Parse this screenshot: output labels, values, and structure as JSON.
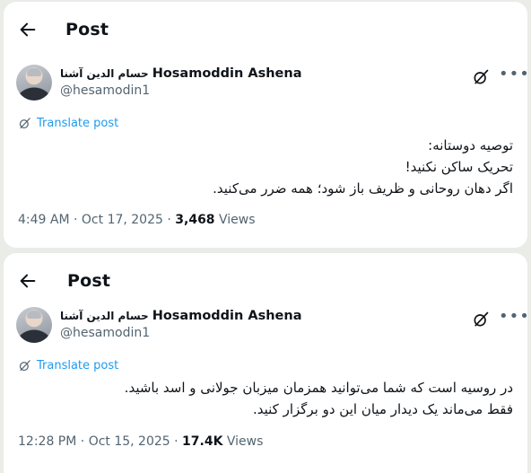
{
  "posts": [
    {
      "header_title": "Post",
      "author": {
        "name_fa": "حسام الدین آشنا",
        "name_en": "Hosamoddin Ashena",
        "handle": "@hesamodin1"
      },
      "translate_label": "Translate post",
      "text_lines": [
        "توصیه دوستانه:",
        "تحریک ساکن نکنید!",
        "اگر دهان روحانی و ظریف باز شود؛ همه ضرر می‌کنید."
      ],
      "time": "4:49 AM",
      "date": "Oct 17, 2025",
      "views_count": "3,468",
      "views_label": "Views"
    },
    {
      "header_title": "Post",
      "author": {
        "name_fa": "حسام الدین آشنا",
        "name_en": "Hosamoddin Ashena",
        "handle": "@hesamodin1"
      },
      "translate_label": "Translate post",
      "text_lines": [
        "در روسیه است که شما می‌توانید همزمان میزبان جولانی و اسد باشید.",
        "فقط می‌ماند یک دیدار میان این دو برگزار کنید."
      ],
      "time": "12:28 PM",
      "date": "Oct 15, 2025",
      "views_count": "17.4K",
      "views_label": "Views"
    }
  ],
  "icons": {
    "back": "arrow-left-icon",
    "grok": "grok-icon",
    "more": "more-horizontal-icon",
    "translate": "translate-icon"
  },
  "colors": {
    "accent": "#1d9bf0",
    "secondary_text": "#536471",
    "primary_text": "#0f1419"
  }
}
